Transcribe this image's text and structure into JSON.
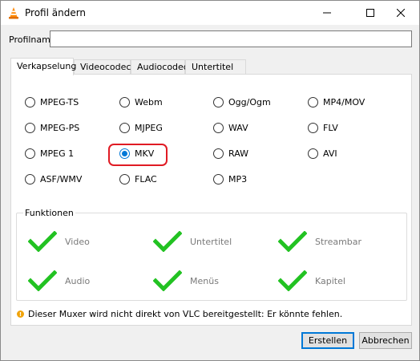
{
  "window": {
    "title": "Profil ändern"
  },
  "profile": {
    "label": "Profilname",
    "value": ""
  },
  "tabs": [
    {
      "label": "Verkapselung",
      "active": true
    },
    {
      "label": "Videocodec",
      "active": false
    },
    {
      "label": "Audiocodec",
      "active": false
    },
    {
      "label": "Untertitel",
      "active": false
    }
  ],
  "encapsulation": {
    "options": [
      {
        "label": "MPEG-TS",
        "checked": false
      },
      {
        "label": "Webm",
        "checked": false
      },
      {
        "label": "Ogg/Ogm",
        "checked": false
      },
      {
        "label": "MP4/MOV",
        "checked": false
      },
      {
        "label": "MPEG-PS",
        "checked": false
      },
      {
        "label": "MJPEG",
        "checked": false
      },
      {
        "label": "WAV",
        "checked": false
      },
      {
        "label": "FLV",
        "checked": false
      },
      {
        "label": "MPEG 1",
        "checked": false
      },
      {
        "label": "MKV",
        "checked": true
      },
      {
        "label": "RAW",
        "checked": false
      },
      {
        "label": "AVI",
        "checked": false
      },
      {
        "label": "ASF/WMV",
        "checked": false
      },
      {
        "label": "FLAC",
        "checked": false
      },
      {
        "label": "MP3",
        "checked": false
      }
    ],
    "highlight_color": "#e01b24"
  },
  "features": {
    "legend": "Funktionen",
    "items": [
      {
        "label": "Video",
        "icon": "checkmark-icon"
      },
      {
        "label": "Untertitel",
        "icon": "checkmark-icon"
      },
      {
        "label": "Streambar",
        "icon": "checkmark-icon"
      },
      {
        "label": "Audio",
        "icon": "checkmark-icon"
      },
      {
        "label": "Menüs",
        "icon": "checkmark-icon"
      },
      {
        "label": "Kapitel",
        "icon": "checkmark-icon"
      }
    ],
    "check_color": "#22c222"
  },
  "warning": {
    "icon": "warning-icon",
    "text": "Dieser Muxer wird nicht direkt von VLC bereitgestellt: Er könnte fehlen."
  },
  "buttons": {
    "create": "Erstellen",
    "cancel": "Abbrechen"
  },
  "colors": {
    "accent": "#0078d7",
    "vlc_orange": "#ff8800"
  }
}
